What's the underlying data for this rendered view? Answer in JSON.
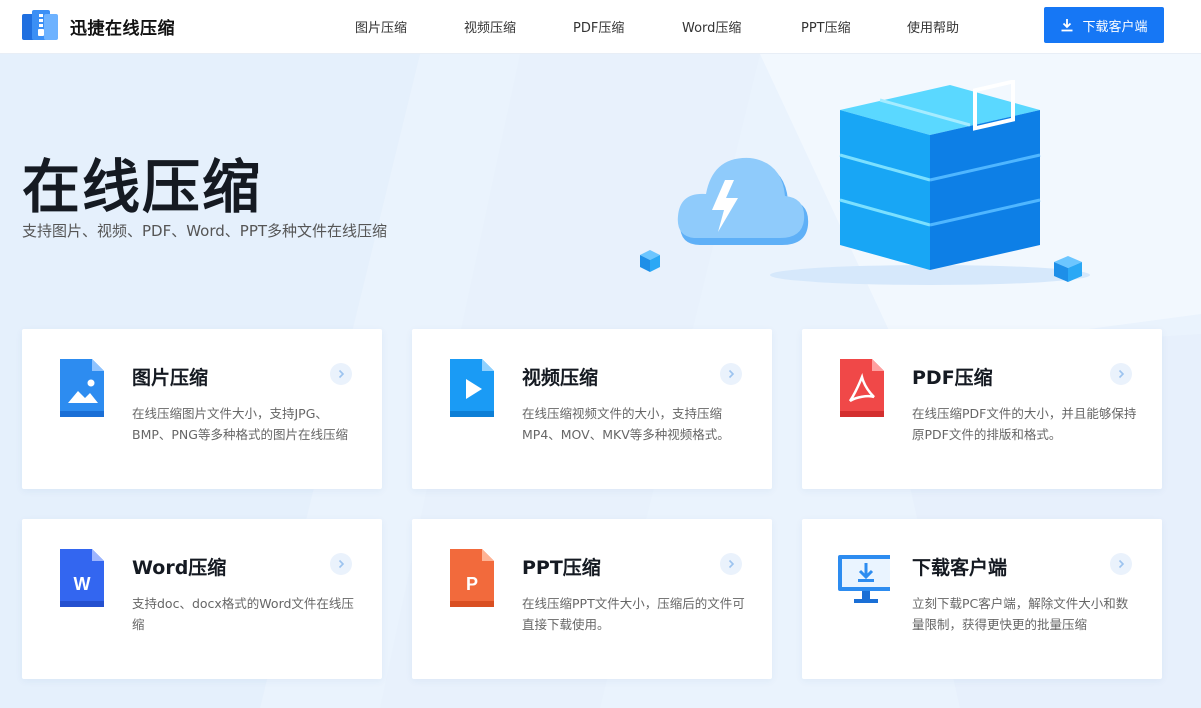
{
  "header": {
    "logo_text": "迅捷在线压缩",
    "nav": [
      {
        "label": "图片压缩"
      },
      {
        "label": "视频压缩"
      },
      {
        "label": "PDF压缩"
      },
      {
        "label": "Word压缩"
      },
      {
        "label": "PPT压缩"
      },
      {
        "label": "使用帮助"
      }
    ],
    "download_label": "下载客户端"
  },
  "hero": {
    "title": "在线压缩",
    "subtitle": "支持图片、视频、PDF、Word、PPT多种文件在线压缩"
  },
  "cards": [
    {
      "title": "图片压缩",
      "desc": "在线压缩图片文件大小，支持JPG、BMP、PNG等多种格式的图片在线压缩",
      "icon": "image-file-icon",
      "color": "#2d8cf0"
    },
    {
      "title": "视频压缩",
      "desc": "在线压缩视频文件的大小，支持压缩MP4、MOV、MKV等多种视频格式。",
      "icon": "video-file-icon",
      "color": "#1a9bf5"
    },
    {
      "title": "PDF压缩",
      "desc": "在线压缩PDF文件的大小，并且能够保持原PDF文件的排版和格式。",
      "icon": "pdf-file-icon",
      "color": "#f04848"
    },
    {
      "title": "Word压缩",
      "desc": "支持doc、docx格式的Word文件在线压缩",
      "icon": "word-file-icon",
      "color": "#3366f0"
    },
    {
      "title": "PPT压缩",
      "desc": "在线压缩PPT文件大小，压缩后的文件可直接下载使用。",
      "icon": "ppt-file-icon",
      "color": "#f26a3c"
    },
    {
      "title": "下载客户端",
      "desc": "立刻下载PC客户端，解除文件大小和数量限制，获得更快更的批量压缩",
      "icon": "monitor-download-icon",
      "color": "#2d8cf0"
    }
  ],
  "colors": {
    "accent": "#1677f5",
    "background": "#eaf3fd"
  }
}
